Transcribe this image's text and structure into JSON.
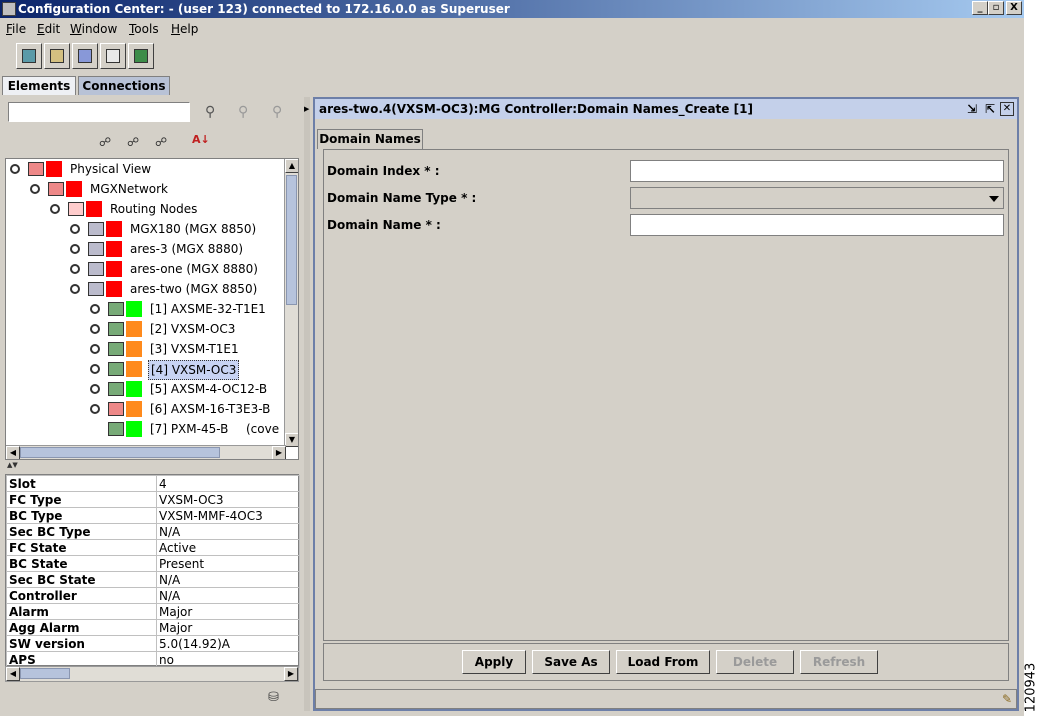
{
  "window": {
    "title": "Configuration Center: - (user 123) connected to 172.16.0.0 as Superuser",
    "controls": [
      "_",
      "▫",
      "X"
    ]
  },
  "menu": [
    "File",
    "Edit",
    "Window",
    "Tools",
    "Help"
  ],
  "toolbar": [
    "network-icon",
    "tools-icon",
    "wizard-icon",
    "config-icon",
    "export-icon"
  ],
  "tabs": [
    {
      "label": "Elements",
      "active": true
    },
    {
      "label": "Connections",
      "active": false
    }
  ],
  "search": {
    "value": ""
  },
  "tree": {
    "nodes": [
      {
        "label": "Physical View",
        "level": 0,
        "status": "red"
      },
      {
        "label": "MGXNetwork",
        "level": 1,
        "status": "red"
      },
      {
        "label": "Routing Nodes",
        "level": 2,
        "status": "red"
      },
      {
        "label": "MGX180 (MGX 8850)",
        "level": 3,
        "status": "red"
      },
      {
        "label": "ares-3 (MGX 8880)",
        "level": 3,
        "status": "red"
      },
      {
        "label": "ares-one (MGX 8880)",
        "level": 3,
        "status": "red"
      },
      {
        "label": "ares-two (MGX 8850)",
        "level": 3,
        "status": "red"
      },
      {
        "label": "[1] AXSME-32-T1E1",
        "level": 4,
        "status": "green"
      },
      {
        "label": "[2] VXSM-OC3",
        "level": 4,
        "status": "orange"
      },
      {
        "label": "[3] VXSM-T1E1",
        "level": 4,
        "status": "orange"
      },
      {
        "label": "[4] VXSM-OC3",
        "level": 4,
        "status": "orange",
        "selected": true
      },
      {
        "label": "[5] AXSM-4-OC12-B",
        "level": 4,
        "status": "green"
      },
      {
        "label": "[6] AXSM-16-T3E3-B",
        "level": 4,
        "status": "orange"
      },
      {
        "label": "[7] PXM-45-B",
        "level": 4,
        "status": "green",
        "suffix": "(cove"
      }
    ]
  },
  "properties": [
    {
      "key": "Slot",
      "value": "4"
    },
    {
      "key": "FC Type",
      "value": "VXSM-OC3"
    },
    {
      "key": "BC Type",
      "value": "VXSM-MMF-4OC3"
    },
    {
      "key": "Sec BC Type",
      "value": "N/A"
    },
    {
      "key": "FC State",
      "value": "Active"
    },
    {
      "key": "BC State",
      "value": "Present"
    },
    {
      "key": "Sec BC State",
      "value": "N/A"
    },
    {
      "key": "Controller",
      "value": "N/A"
    },
    {
      "key": "Alarm",
      "value": "Major"
    },
    {
      "key": "Agg Alarm",
      "value": "Major"
    },
    {
      "key": "SW version",
      "value": "5.0(14.92)A"
    },
    {
      "key": "APS",
      "value": "no"
    }
  ],
  "dialog": {
    "title": "ares-two.4(VXSM-OC3):MG Controller:Domain Names_Create [1]",
    "tab": "Domain Names",
    "fields": [
      {
        "label": "Domain Index * :",
        "value": "",
        "type": "text"
      },
      {
        "label": "Domain Name Type * :",
        "value": "",
        "type": "select"
      },
      {
        "label": "Domain Name * :",
        "value": "",
        "type": "text"
      }
    ],
    "buttons": [
      {
        "label": "Apply",
        "enabled": true
      },
      {
        "label": "Save As",
        "enabled": true
      },
      {
        "label": "Load From",
        "enabled": true
      },
      {
        "label": "Delete",
        "enabled": false
      },
      {
        "label": "Refresh",
        "enabled": false
      }
    ]
  },
  "figure_id": "120943",
  "colors": {
    "red": "#ff0000",
    "green": "#00ff00",
    "orange": "#ff8a1c",
    "selection": "#c8d4f4"
  }
}
